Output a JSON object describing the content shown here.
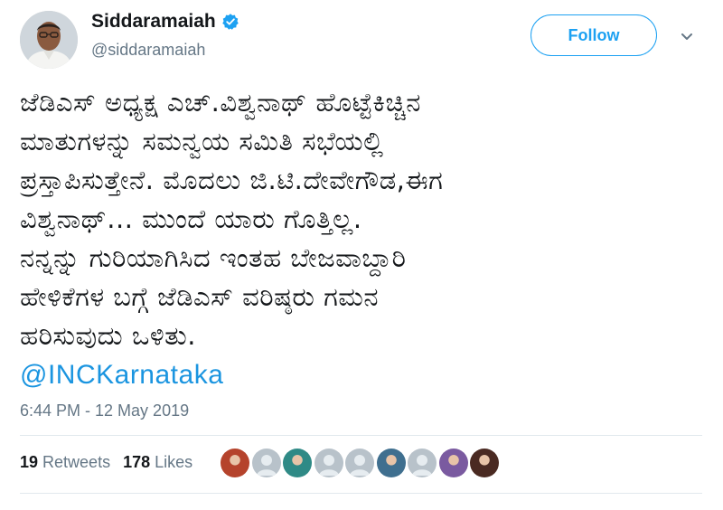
{
  "user": {
    "display_name": "Siddaramaiah",
    "handle": "@siddaramaiah",
    "verified": true
  },
  "follow_button": {
    "label": "Follow"
  },
  "tweet": {
    "lines": [
      "ಜೆಡಿಎಸ್ ಅಧ್ಯಕ್ಷ ಎಚ್.ವಿಶ್ವನಾಥ್ ಹೊಟ್ಟೆಕಿಚ್ಚಿನ",
      "ಮಾತುಗಳನ್ನು ಸಮನ್ವಯ ಸಮಿತಿ ಸಭೆಯಲ್ಲಿ",
      "ಪ್ರಸ್ತಾಪಿಸುತ್ತೇನೆ. ಮೊದಲು ಜಿ.ಟಿ.ದೇವೇಗೌಡ,ಈಗ",
      "ವಿಶ್ವನಾಥ್... ಮುಂದೆ ಯಾರು ಗೊತ್ತಿಲ್ಲ.",
      "ನನ್ನನ್ನು ಗುರಿಯಾಗಿಸಿದ ಇಂತಹ ಬೇಜವಾಬ್ದಾರಿ",
      "ಹೇಳಿಕೆಗಳ ಬಗ್ಗೆ ಜೆಡಿಎಸ್ ವರಿಷ್ಠರು ಗಮನ",
      "ಹರಿಸುವುದು ಒಳಿತು."
    ],
    "mention": "@INCKarnataka",
    "timestamp": "6:44 PM - 12 May 2019"
  },
  "stats": {
    "retweets_count": "19",
    "retweets_label": "Retweets",
    "likes_count": "178",
    "likes_label": "Likes"
  },
  "likers": [
    {
      "kind": "photo",
      "color": "#b5432c"
    },
    {
      "kind": "default"
    },
    {
      "kind": "photo",
      "color": "#2f8a86"
    },
    {
      "kind": "default"
    },
    {
      "kind": "default"
    },
    {
      "kind": "photo",
      "color": "#3f6f8f"
    },
    {
      "kind": "default"
    },
    {
      "kind": "photo",
      "color": "#7a5aa0"
    },
    {
      "kind": "photo",
      "color": "#4a2a22"
    }
  ],
  "colors": {
    "accent": "#1da1f2",
    "mention": "#1b95e0",
    "muted": "#657786",
    "text": "#14171a"
  },
  "icons": {
    "verified": "verified-badge-icon",
    "caret": "chevron-down-icon",
    "default_avatar": "default-profile-icon"
  }
}
